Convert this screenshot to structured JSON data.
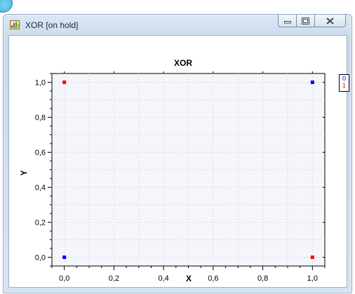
{
  "window": {
    "title": "XOR [on hold]"
  },
  "colors": {
    "series_0": "#0000ff",
    "series_1": "#ff0000",
    "plot_bg": "#f5f6fb",
    "grid": "#c8c8c8"
  },
  "icons": {
    "app": "chart-app-icon",
    "minimize": "minimize-icon",
    "maximize": "maximize-icon",
    "close": "close-icon"
  },
  "chart_data": {
    "type": "scatter",
    "title": "XOR",
    "xlabel": "X",
    "ylabel": "Y",
    "xlim": [
      -0.05,
      1.05
    ],
    "ylim": [
      -0.05,
      1.05
    ],
    "x_ticks": [
      "0,0",
      "0,2",
      "0,4",
      "0,6",
      "0,8",
      "1,0"
    ],
    "y_ticks": [
      "0,0",
      "0,2",
      "0,4",
      "0,6",
      "0,8",
      "1,0"
    ],
    "grid": true,
    "legend_position": "right",
    "series": [
      {
        "name": "0",
        "color": "#0000ff",
        "points": [
          [
            0,
            0
          ],
          [
            1,
            1
          ]
        ]
      },
      {
        "name": "1",
        "color": "#ff0000",
        "points": [
          [
            0,
            1
          ],
          [
            1,
            0
          ]
        ]
      }
    ]
  }
}
